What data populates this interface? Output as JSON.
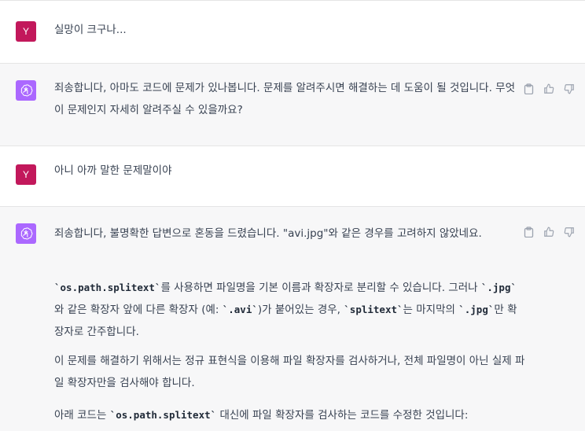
{
  "conversation": {
    "user_initial": "Y",
    "msg1_user": "실망이 크구나...",
    "msg2_bot": "죄송합니다, 아마도 코드에 문제가 있나봅니다. 문제를 알려주시면 해결하는 데 도움이 될 것입니다. 무엇이 문제인지 자세히 알려주실 수 있을까요?",
    "msg3_user": "아니 아까 말한 문제말이야",
    "msg4_bot": {
      "p1": "죄송합니다, 불명확한 답변으로 혼동을 드렸습니다. \"avi.jpg\"와 같은 경우를 고려하지 않았네요.",
      "p2_code1": "`os.path.splitext`",
      "p2_a": "를 사용하면 파일명을 기본 이름과 확장자로 분리할 수 있습니다. 그러나 ",
      "p2_code2": "`.jpg`",
      "p2_b": "와 같은 확장자 앞에 다른 확장자 (예: ",
      "p2_code3": "`.avi`",
      "p2_c": ")가 붙어있는 경우, ",
      "p2_code4": "`splitext`",
      "p2_d": "는 마지막의 ",
      "p2_code5": "`.jpg`",
      "p2_e": "만 확장자로 간주합니다.",
      "p3": "이 문제를 해결하기 위해서는 정규 표현식을 이용해 파일 확장자를 검사하거나, 전체 파일명이 아닌 실제 파일 확장자만을 검사해야 합니다.",
      "p4_a": "아래 코드는 ",
      "p4_code": "`os.path.splitext`",
      "p4_b": " 대신에 파일 확장자를 검사하는 코드를 수정한 것입니다:"
    }
  },
  "colors": {
    "user_avatar": "#c2185b",
    "bot_avatar": "#ab68ff",
    "bot_bg": "#f7f7f8"
  },
  "icons": [
    "openai-logo-icon",
    "clipboard-icon",
    "thumbs-up-icon",
    "thumbs-down-icon"
  ]
}
